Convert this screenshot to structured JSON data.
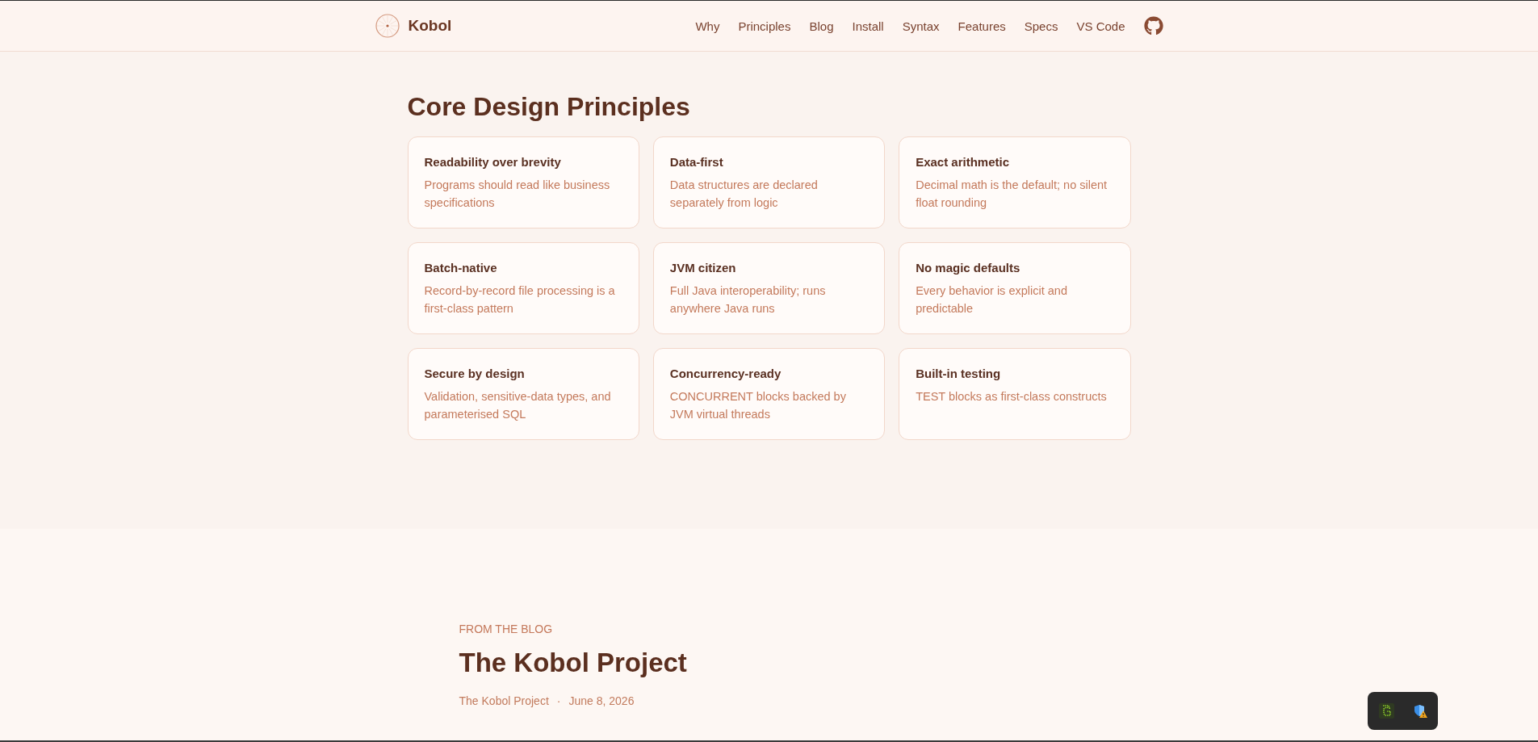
{
  "nav": {
    "brand": "Kobol",
    "links": [
      "Why",
      "Principles",
      "Blog",
      "Install",
      "Syntax",
      "Features",
      "Specs",
      "VS Code"
    ]
  },
  "principles": {
    "title": "Core Design Principles",
    "cards": [
      {
        "title": "Readability over brevity",
        "description": "Programs should read like business specifications"
      },
      {
        "title": "Data-first",
        "description": "Data structures are declared separately from logic"
      },
      {
        "title": "Exact arithmetic",
        "description": "Decimal math is the default; no silent float rounding"
      },
      {
        "title": "Batch-native",
        "description": "Record-by-record file processing is a first-class pattern"
      },
      {
        "title": "JVM citizen",
        "description": "Full Java interoperability; runs anywhere Java runs"
      },
      {
        "title": "No magic defaults",
        "description": "Every behavior is explicit and predictable"
      },
      {
        "title": "Secure by design",
        "description": "Validation, sensitive-data types, and parameterised SQL"
      },
      {
        "title": "Concurrency-ready",
        "description": "CONCURRENT blocks backed by JVM virtual threads"
      },
      {
        "title": "Built-in testing",
        "description": "TEST blocks as first-class constructs"
      }
    ]
  },
  "blog": {
    "eyebrow": "FROM THE BLOG",
    "title": "The Kobol Project",
    "author": "The Kobol Project",
    "separator": "·",
    "date": "June 8, 2026"
  }
}
